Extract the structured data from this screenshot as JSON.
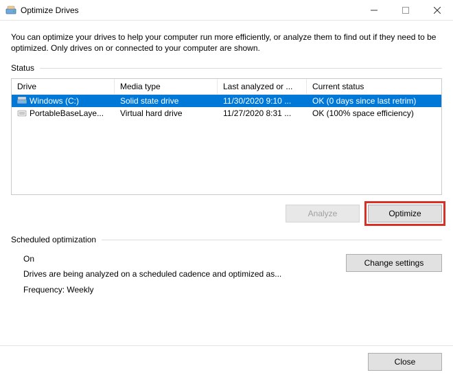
{
  "window": {
    "title": "Optimize Drives"
  },
  "intro": "You can optimize your drives to help your computer run more efficiently, or analyze them to find out if they need to be optimized. Only drives on or connected to your computer are shown.",
  "status": {
    "label": "Status",
    "columns": {
      "drive": "Drive",
      "media": "Media type",
      "last": "Last analyzed or ...",
      "status": "Current status"
    },
    "rows": [
      {
        "drive": "Windows (C:)",
        "media": "Solid state drive",
        "last": "11/30/2020 9:10 ...",
        "status": "OK (0 days since last retrim)",
        "selected": true
      },
      {
        "drive": "PortableBaseLaye...",
        "media": "Virtual hard drive",
        "last": "11/27/2020 8:31 ...",
        "status": "OK (100% space efficiency)",
        "selected": false
      }
    ]
  },
  "buttons": {
    "analyze": "Analyze",
    "optimize": "Optimize",
    "change_settings": "Change settings",
    "close": "Close"
  },
  "schedule": {
    "label": "Scheduled optimization",
    "state": "On",
    "desc": "Drives are being analyzed on a scheduled cadence and optimized as...",
    "frequency_label": "Frequency:",
    "frequency_value": "Weekly"
  }
}
